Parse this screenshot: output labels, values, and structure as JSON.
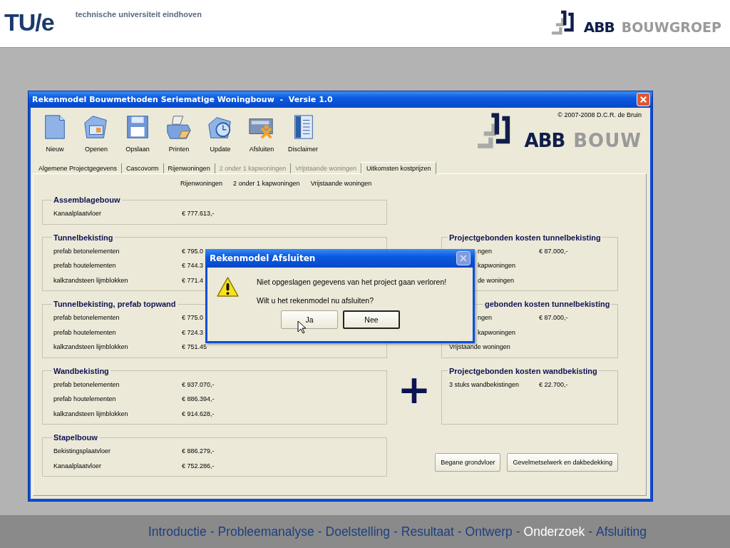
{
  "slide_header": {
    "logo": "TU/e",
    "university": "technische universiteit eindhoven",
    "brand_mark": "ABB",
    "brand_word": "BOUWGROEP"
  },
  "window": {
    "title": "Rekenmodel Bouwmethoden Seriematige Woningbouw  -  Versie 1.0"
  },
  "toolbar": [
    {
      "kind": "new",
      "label": "Nieuw"
    },
    {
      "kind": "open",
      "label": "Openen"
    },
    {
      "kind": "save",
      "label": "Opslaan"
    },
    {
      "kind": "print",
      "label": "Printen"
    },
    {
      "kind": "update",
      "label": "Update"
    },
    {
      "kind": "exit",
      "label": "Afsluiten"
    },
    {
      "kind": "text",
      "label": "Disclaimer"
    }
  ],
  "copyright": "© 2007-2008 D.C.R. de Bruin",
  "brand": {
    "mark": "ABB",
    "word": "BOUW"
  },
  "tabs": [
    {
      "label": "Algemene Projectgegevens",
      "selected": false,
      "disabled": false
    },
    {
      "label": "Cascovorm",
      "selected": false,
      "disabled": false
    },
    {
      "label": "Rijenwoningen",
      "selected": false,
      "disabled": false
    },
    {
      "label": "2 onder 1 kapwoningen",
      "selected": false,
      "disabled": true
    },
    {
      "label": "Vrijstaande woningen",
      "selected": false,
      "disabled": true
    },
    {
      "label": "Uitkomsten kostprijzen",
      "selected": true,
      "disabled": false
    }
  ],
  "column_headers": [
    "Rijenwoningen",
    "2 onder 1 kapwoningen",
    "Vrijstaande woningen"
  ],
  "cost_groups": [
    {
      "title": "Assemblagebouw",
      "rows": [
        {
          "label": "Kanaalplaatvloer",
          "value": "€ 777.613,-"
        }
      ]
    },
    {
      "title": "Tunnelbekisting",
      "rows": [
        {
          "label": "prefab betonelementen",
          "value": "€ 795.0"
        },
        {
          "label": "prefab houtelementen",
          "value": "€ 744.3"
        },
        {
          "label": "kalkzandsteen lijmblokken",
          "value": "€ 771.4"
        }
      ]
    },
    {
      "title": "Tunnelbekisting, prefab topwand",
      "rows": [
        {
          "label": "prefab betonelementen",
          "value": "€ 775.0"
        },
        {
          "label": "prefab houtelementen",
          "value": "€ 724.3"
        },
        {
          "label": "kalkzandsteen lijmblokken",
          "value": "€ 751.45"
        }
      ]
    },
    {
      "title": "Wandbekisting",
      "rows": [
        {
          "label": "prefab betonelementen",
          "value": "€ 937.070,-"
        },
        {
          "label": "prefab houtelementen",
          "value": "€ 886.394,-"
        },
        {
          "label": "kalkzandsteen lijmblokken",
          "value": "€ 914.628,-"
        }
      ]
    },
    {
      "title": "Stapelbouw",
      "rows": [
        {
          "label": "Bekistingsplaatvloer",
          "value": "€ 886.279,-"
        },
        {
          "label": "Kanaalplaatvloer",
          "value": "€ 752.286,-"
        }
      ]
    }
  ],
  "project_groups": [
    {
      "title": "Projectgebonden kosten tunnelbekisting",
      "rows": [
        {
          "label": "ngen",
          "value": "€ 87.000,-"
        },
        {
          "label": "kapwoningen"
        },
        {
          "label": "de woningen"
        }
      ]
    },
    {
      "title": "gebonden kosten tunnelbekisting",
      "rows": [
        {
          "label": "ngen",
          "value": "€ 87.000,-"
        },
        {
          "label": "kapwoningen"
        },
        {
          "label": "Vrijstaande woningen"
        }
      ]
    },
    {
      "title": "Projectgebonden kosten wandbekisting",
      "rows": [
        {
          "label": "3 stuks wandbekistingen",
          "value": "€ 22.700,-"
        }
      ]
    }
  ],
  "plus_sign": "+",
  "buttons": [
    "Begane grondvloer",
    "Gevelmetselwerk en dakbedekking"
  ],
  "dialog": {
    "title": "Rekenmodel Afsluiten",
    "messages": [
      "Niet opgeslagen gegevens van het project gaan verloren!",
      "Wilt u het rekenmodel nu afsluiten?"
    ],
    "buttons": [
      {
        "label": "Ja",
        "focused": false
      },
      {
        "label": "Nee",
        "focused": true
      }
    ]
  },
  "footer_nav": [
    {
      "label": "Introductie",
      "selected": false
    },
    {
      "label": "Probleemanalyse",
      "selected": false
    },
    {
      "label": "Doelstelling",
      "selected": false
    },
    {
      "label": "Resultaat",
      "selected": false
    },
    {
      "label": "Ontwerp",
      "selected": false
    },
    {
      "label": "Onderzoek",
      "selected": true
    },
    {
      "label": "Afsluiting",
      "selected": false
    }
  ],
  "footer_separator": "-"
}
